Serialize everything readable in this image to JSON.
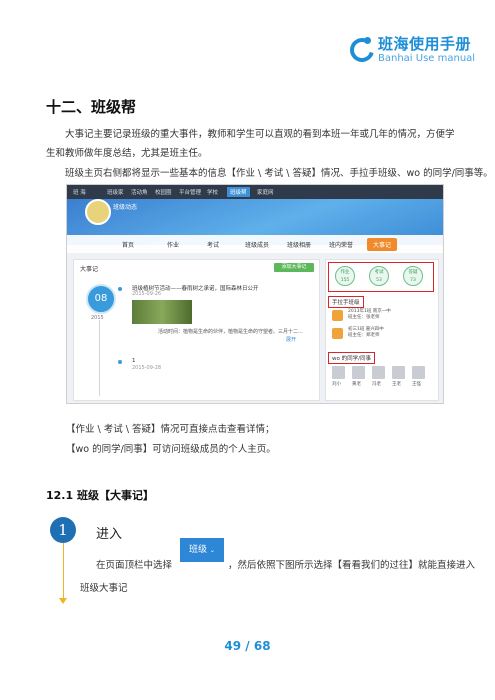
{
  "header": {
    "logo_cn": "班海使用手册",
    "logo_en": "Banhai Use manual"
  },
  "section": {
    "title": "十二、班级帮",
    "para1": "大事记主要记录班级的重大事件，教师和学生可以直观的看到本班一年或几年的情况，方便学生和教师做年度总结，尤其是班主任。",
    "para2": "班级主页右侧都将显示一些基本的信息【作业 \\ 考试 \\ 答疑】情况、手拉手班级、wo 的同学/同事等。",
    "note1": "【作业 \\ 考试 \\ 答疑】情况可直接点击查看详情；",
    "note2": "【wo 的同学/同事】可访问班级成员的个人主页。"
  },
  "screenshot": {
    "nav_items": [
      "班 海",
      "班级家",
      "活动角",
      "校园圈",
      "平台管理",
      "学校",
      "班级帮",
      "家庭网"
    ],
    "nav_active_index": 6,
    "banner_title": "班级动态",
    "tabs": [
      "首页",
      "作业",
      "考试",
      "班级成员",
      "班级相册",
      "班内荣誉",
      "大事记"
    ],
    "tab_active_index": 6,
    "panel_title": "大事记",
    "add_button": "添加大事记",
    "date_day": "08",
    "date_year": "2015",
    "event1_title": "班级植树节活动——春雨树之承诺，国际森林日公开",
    "event1_date": "2015-09-26",
    "event1_desc": "活动时间：植物是生命的伙伴，植物是生命的守望者。三月十二...",
    "event1_more": "展开",
    "event2_title": "1",
    "event2_date": "2015-09-28",
    "stats": [
      {
        "label": "作业",
        "value": "155"
      },
      {
        "label": "考试",
        "value": "53"
      },
      {
        "label": "答疑",
        "value": "73"
      }
    ],
    "friends_title": "手拉手班级",
    "friends": [
      {
        "line1": "2013年1班 南京一中",
        "line2": "班主任：张老师"
      },
      {
        "line1": "初三1班 嘉兴四中",
        "line2": "班主任：郑老师"
      }
    ],
    "mates_title": "wo 的同学/同事",
    "mates": [
      "刘小",
      "黄老",
      "冯老",
      "王老",
      "王怪"
    ],
    "colors": {
      "accent": "#1e8fd6",
      "highlight": "#d9262c",
      "active_tab": "#f08a2c"
    }
  },
  "subsection": {
    "title": "12.1 班级【大事记】",
    "step_number": "1",
    "step_title": "进入",
    "step_text_before": "在页面顶栏中选择",
    "class_button": "班级",
    "step_text_after": "，然后依照下图所示选择【看看我们的过往】就能直接进入",
    "step_text_line2": "班级大事记"
  },
  "footer": {
    "page_number": "49 / 68"
  }
}
